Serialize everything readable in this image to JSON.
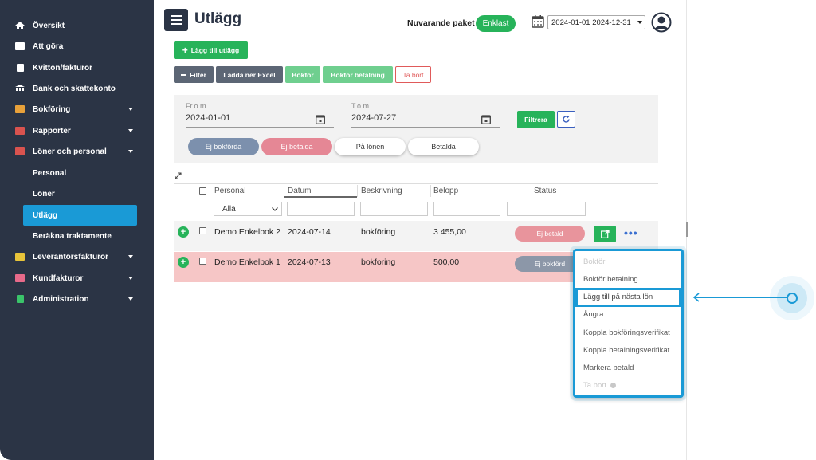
{
  "sidebar": {
    "items": [
      {
        "label": "Översikt",
        "icon": "home-icon"
      },
      {
        "label": "Att göra",
        "icon": "list-icon"
      },
      {
        "label": "Kvitton/fakturor",
        "icon": "receipt-icon"
      },
      {
        "label": "Bank och skattekonto",
        "icon": "bank-icon"
      },
      {
        "label": "Bokföring",
        "icon": "book-icon"
      },
      {
        "label": "Rapporter",
        "icon": "report-icon"
      },
      {
        "label": "Löner och personal",
        "icon": "salary-icon"
      },
      {
        "label": "Leverantörsfakturor",
        "icon": "supplier-invoice-icon"
      },
      {
        "label": "Kundfakturor",
        "icon": "customer-invoice-icon"
      },
      {
        "label": "Administration",
        "icon": "admin-icon"
      }
    ],
    "subitems": [
      "Personal",
      "Löner",
      "Utlägg",
      "Beräkna traktamente"
    ]
  },
  "header": {
    "title": "Utlägg",
    "package_label": "Nuvarande paket",
    "package_badge": "Enklast",
    "year_range": "2024-01-01 2024-12-31"
  },
  "toolbar": {
    "add_label": "Lägg till utlägg",
    "filter_label": "Filter",
    "excel_label": "Ladda ner Excel",
    "bokfor_label": "Bokför",
    "bokfor_betalning_label": "Bokför betalning",
    "tabort_label": "Ta bort"
  },
  "filter": {
    "from_label": "Fr.o.m",
    "from_value": "2024-01-01",
    "to_label": "T.o.m",
    "to_value": "2024-07-27",
    "filtrera_label": "Filtrera",
    "pills": [
      "Ej bokförda",
      "Ej betalda",
      "På lönen",
      "Betalda"
    ]
  },
  "table": {
    "headers": [
      "Personal",
      "Datum",
      "Beskrivning",
      "Belopp",
      "Status"
    ],
    "personal_filter": "Alla",
    "rows": [
      {
        "personal": "Demo Enkelbok 2",
        "datum": "2024-07-14",
        "beskrivning": "bokföring",
        "belopp": "3 455,00",
        "status": "Ej betald"
      },
      {
        "personal": "Demo Enkelbok 1",
        "datum": "2024-07-13",
        "beskrivning": "bokforing",
        "belopp": "500,00",
        "status": "Ej bokförd"
      }
    ]
  },
  "dropdown": {
    "items": [
      {
        "label": "Bokför",
        "disabled": true
      },
      {
        "label": "Bokför betalning",
        "disabled": false
      },
      {
        "label": "Lägg till på nästa lön",
        "disabled": false
      },
      {
        "label": "Ångra",
        "disabled": false
      },
      {
        "label": "Koppla bokföringsverifikat",
        "disabled": false
      },
      {
        "label": "Koppla betalningsverifikat",
        "disabled": false
      },
      {
        "label": "Markera betald",
        "disabled": false
      },
      {
        "label": "Ta bort",
        "disabled": true
      }
    ]
  },
  "colors": {
    "sidebar_bg": "#2b3445",
    "accent_blue": "#1a9ad6",
    "green": "#27b35a",
    "row_highlight": "#f6c6c6"
  }
}
